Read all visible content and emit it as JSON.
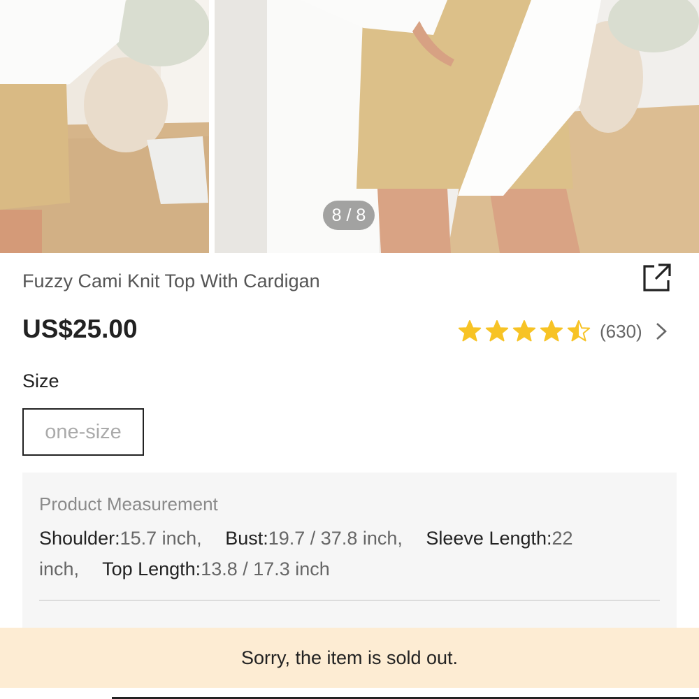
{
  "gallery": {
    "counter": "8 / 8"
  },
  "product": {
    "title": "Fuzzy Cami Knit Top With Cardigan",
    "price": "US$25.00",
    "rating": {
      "stars": 4.5,
      "count": "(630)"
    }
  },
  "size": {
    "label": "Size",
    "options": [
      "one-size"
    ]
  },
  "measurement": {
    "heading": "Product Measurement",
    "items": [
      {
        "key": "Shoulder:",
        "value": "15.7 inch,"
      },
      {
        "key": "Bust:",
        "value": "19.7 / 37.8 inch,"
      },
      {
        "key": "Sleeve Length:",
        "value": "22 inch,"
      },
      {
        "key": "Top Length:",
        "value": "13.8 / 17.3 inch"
      }
    ]
  },
  "notice": {
    "sold_out": "Sorry, the item is sold out."
  },
  "colors": {
    "star": "#f7c325",
    "sold_out_bg": "#fdecd3",
    "panel_bg": "#f6f6f6"
  },
  "icons": {
    "share": "share-external-icon",
    "chevron": "chevron-right-icon"
  }
}
